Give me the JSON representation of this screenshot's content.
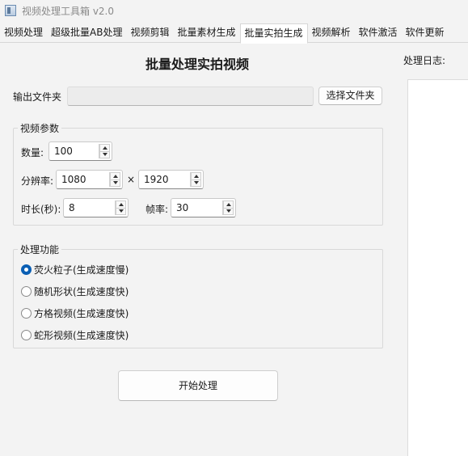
{
  "window": {
    "title": "视频处理工具箱 v2.0"
  },
  "tabs": [
    {
      "label": "视频处理"
    },
    {
      "label": "超级批量AB处理"
    },
    {
      "label": "视频剪辑"
    },
    {
      "label": "批量素材生成"
    },
    {
      "label": "批量实拍生成",
      "active": true
    },
    {
      "label": "视频解析"
    },
    {
      "label": "软件激活"
    },
    {
      "label": "软件更新"
    }
  ],
  "main": {
    "title": "批量处理实拍视频",
    "output": {
      "label": "输出文件夹",
      "value": "",
      "button": "选择文件夹"
    },
    "params": {
      "group_title": "视频参数",
      "count_label": "数量:",
      "count_value": "100",
      "resolution_label": "分辨率:",
      "width_value": "1080",
      "times": "×",
      "height_value": "1920",
      "duration_label": "时长(秒):",
      "duration_value": "8",
      "fps_label": "帧率:",
      "fps_value": "30"
    },
    "functions": {
      "group_title": "处理功能",
      "options": [
        {
          "label": "荧火粒子(生成速度慢)",
          "checked": true
        },
        {
          "label": "随机形状(生成速度快)",
          "checked": false
        },
        {
          "label": "方格视频(生成速度快)",
          "checked": false
        },
        {
          "label": "蛇形视频(生成速度快)",
          "checked": false
        }
      ]
    },
    "start_button": "开始处理"
  },
  "log": {
    "title": "处理日志:"
  }
}
